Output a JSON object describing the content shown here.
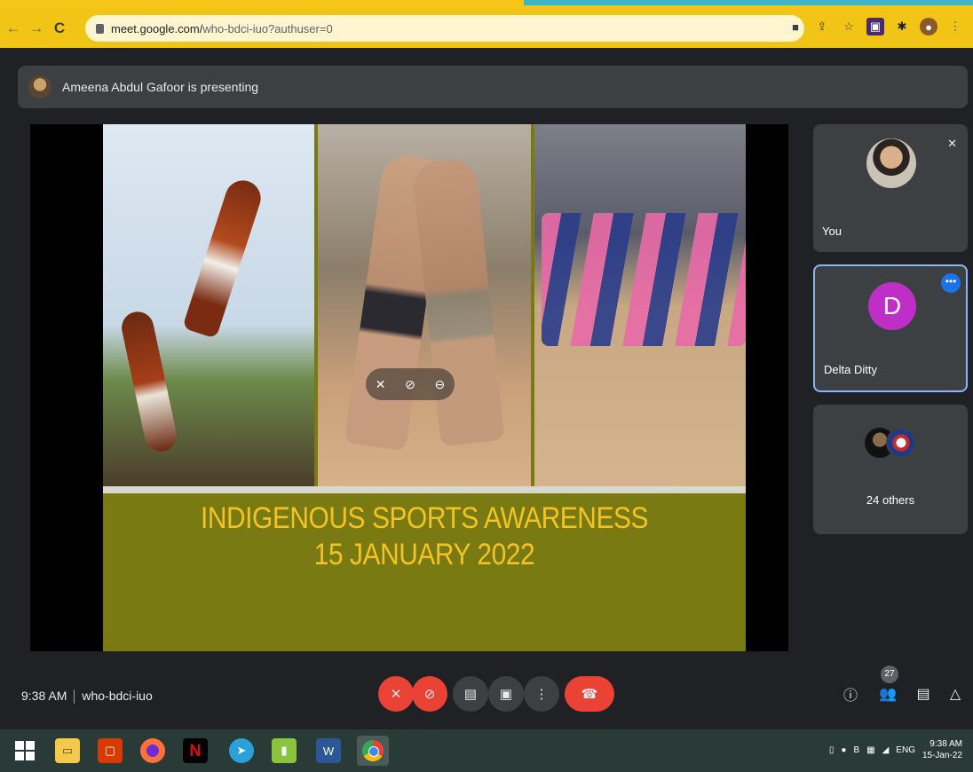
{
  "browser": {
    "url_host": "meet.google.com/",
    "url_path": "who-bdci-iuo?authuser=0"
  },
  "banner": {
    "presenter_text": "Ameena Abdul Gafoor is presenting"
  },
  "slide": {
    "title_line1": "INDIGENOUS SPORTS AWARENESS",
    "title_line2": "15 JANUARY 2022"
  },
  "participants": {
    "you_label": "You",
    "delta_label": "Delta Ditty",
    "delta_initial": "D",
    "others_label": "24 others"
  },
  "meeting": {
    "time": "9:38 AM",
    "code": "who-bdci-iuo",
    "people_count": "27"
  },
  "taskbar": {
    "tray_lang": "ENG",
    "clock_time": "9:38 AM",
    "clock_date": "15-Jan-22"
  },
  "colors": {
    "accent_red": "#ea4335",
    "slide_title": "#f3c421",
    "active_tile_border": "#8ab4f8"
  }
}
